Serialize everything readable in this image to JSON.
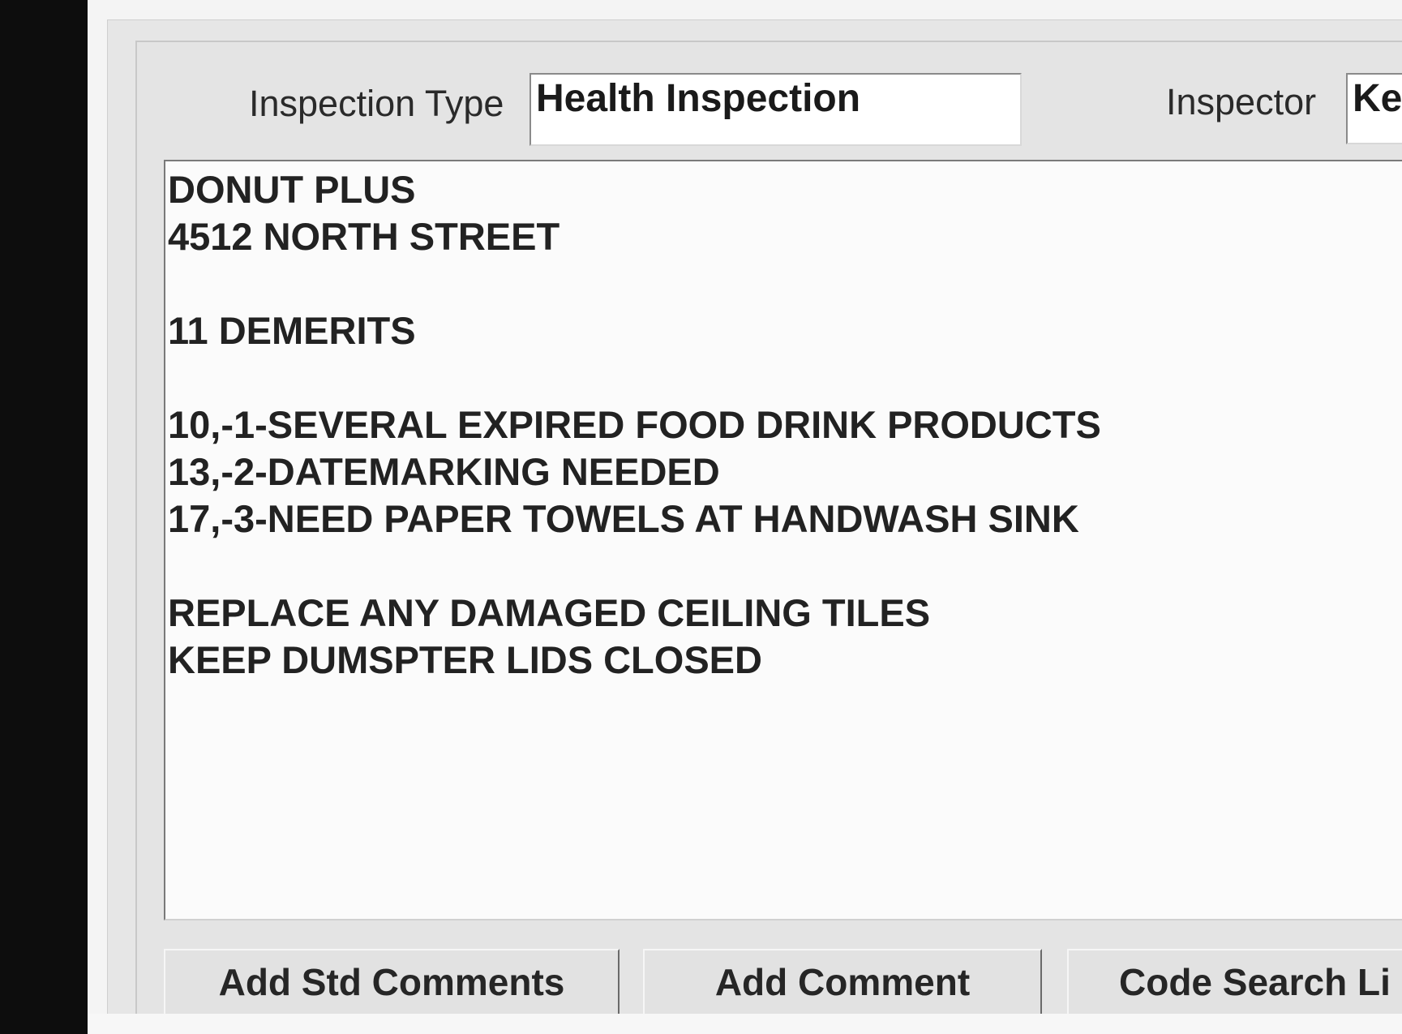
{
  "header": {
    "inspection_type_label": "Inspection Type",
    "inspection_type_value": "Health Inspection",
    "inspector_label": "Inspector",
    "inspector_value": "Ke"
  },
  "comments": {
    "lines": [
      "DONUT PLUS",
      "4512 NORTH STREET",
      "",
      "11 DEMERITS",
      "",
      "10,-1-SEVERAL EXPIRED FOOD DRINK PRODUCTS",
      "13,-2-DATEMARKING NEEDED",
      "17,-3-NEED PAPER TOWELS AT HANDWASH SINK",
      "",
      "REPLACE ANY DAMAGED CEILING TILES",
      "KEEP DUMSPTER LIDS CLOSED"
    ]
  },
  "buttons": {
    "add_std_comments": "Add Std Comments",
    "add_comment": "Add Comment",
    "code_search": "Code Search Li"
  }
}
